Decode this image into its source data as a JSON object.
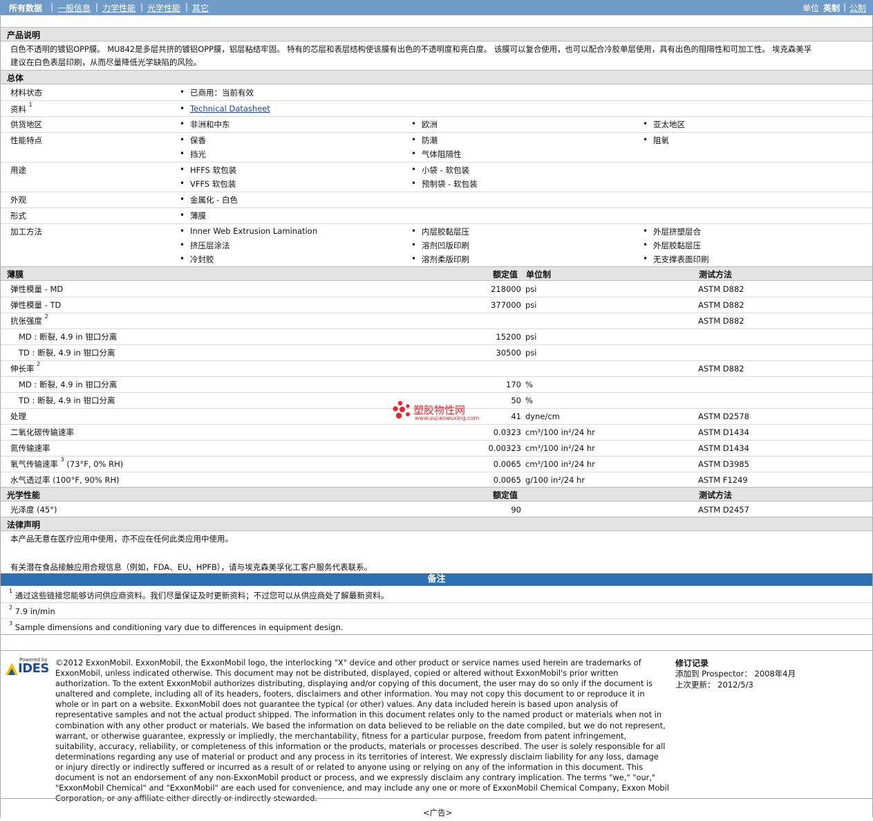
{
  "nav": {
    "items": [
      "所有数据",
      "一般信息",
      "力学性能",
      "光学性能",
      "其它"
    ],
    "separator": "|",
    "units_label": "单位",
    "unit_english": "英制",
    "unit_metric": "公制"
  },
  "product": {
    "heading": "产品说明",
    "line1": "白色不透明的镀铝OPP膜。 MU842是多层共挤的镀铝OPP膜，铝层粘结牢固。 特有的芯层和表层结构使该膜有出色的不透明度和亮白度。 该膜可以复合使用，也可以配合冷胶单层使用，具有出色的阻隔性和可加工性。 埃克森美孚",
    "line2": "建议在白色表层印刷，从而尽量降低光学缺陷的风险。"
  },
  "general": {
    "heading": "总体",
    "rows": [
      {
        "label": "材料状态",
        "values": [
          "已商用：当前有效"
        ]
      },
      {
        "label": "资料",
        "sup": "1",
        "link": "Technical Datasheet"
      },
      {
        "label": "供货地区",
        "values": [
          "非洲和中东",
          "欧洲",
          "亚太地区"
        ]
      },
      {
        "label": "性能特点",
        "values": [
          "保香",
          "防潮",
          "阻氧",
          "挡光",
          "气体阻隔性"
        ]
      },
      {
        "label": "用途",
        "values": [
          "HFFS 软包装",
          "小袋 - 软包装",
          "VFFS 软包装",
          "预制袋 - 软包装"
        ]
      },
      {
        "label": "外观",
        "values": [
          "金属化 - 白色"
        ]
      },
      {
        "label": "形式",
        "values": [
          "薄膜"
        ]
      },
      {
        "label": "加工方法",
        "values": [
          "Inner Web Extrusion Lamination",
          "内层胶黏层压",
          "外层挤塑层合",
          "挤压层涂法",
          "溶剂凹版印刷",
          "外层胶黏层压",
          "冷封胶",
          "溶剂柔版印刷",
          "无支撑表面印刷"
        ]
      }
    ]
  },
  "film": {
    "heading": "薄膜",
    "col_value": "额定值",
    "col_unit": "单位制",
    "col_method": "测试方法",
    "rows": [
      {
        "label": "弹性模量 - MD",
        "value": "218000",
        "unit": "psi",
        "method": "ASTM D882"
      },
      {
        "label": "弹性模量 - TD",
        "value": "377000",
        "unit": "psi",
        "method": "ASTM D882"
      },
      {
        "label": "抗张强度",
        "sup": "2",
        "value": "",
        "unit": "",
        "method": "ASTM D882"
      },
      {
        "label": "MD : 断裂, 4.9 in 钳口分离",
        "value": "15200",
        "unit": "psi",
        "method": ""
      },
      {
        "label": "TD : 断裂, 4.9 in 钳口分离",
        "value": "30500",
        "unit": "psi",
        "method": ""
      },
      {
        "label": "伸长率",
        "sup": "2",
        "value": "",
        "unit": "",
        "method": "ASTM D882"
      },
      {
        "label": "MD : 断裂, 4.9 in 钳口分离",
        "value": "170",
        "unit": "%",
        "method": ""
      },
      {
        "label": "TD : 断裂, 4.9 in 钳口分离",
        "value": "50",
        "unit": "%",
        "method": ""
      },
      {
        "label": "处理",
        "value": "41",
        "unit": "dyne/cm",
        "method": "ASTM D2578"
      },
      {
        "label": "二氧化碳传输速率",
        "value": "0.0323",
        "unit": "cm³/100 in²/24 hr",
        "method": "ASTM D1434"
      },
      {
        "label": "氮传输速率",
        "value": "0.00323",
        "unit": "cm³/100 in²/24 hr",
        "method": "ASTM D1434"
      },
      {
        "label": "氧气传输速率",
        "sup": "3",
        "suffix": "(73°F, 0% RH)",
        "value": "0.0065",
        "unit": "cm³/100 in²/24 hr",
        "method": "ASTM D3985"
      },
      {
        "label": "水气透过率 (100°F, 90% RH)",
        "value": "0.0065",
        "unit": "g/100 in²/24 hr",
        "method": "ASTM F1249"
      }
    ]
  },
  "optical": {
    "heading": "光学性能",
    "col_value": "额定值",
    "col_method": "测试方法",
    "row": {
      "label": "光泽度 (45°)",
      "value": "90",
      "method": "ASTM D2457"
    }
  },
  "legal": {
    "heading": "法律声明",
    "line1": "本产品无意在医疗应用中使用，亦不应在任何此类应用中使用。",
    "line2": "有关潜在食品接触应用合规信息（例如，FDA、EU、HPFB），请与埃克森美孚化工客户服务代表联系。"
  },
  "notes": {
    "heading": "备注",
    "items": [
      {
        "n": "1",
        "text": "通过这些链接您能够访问供应商资料。我们尽量保证及时更新资料；不过您可以从供应商处了解最新资料。"
      },
      {
        "n": "2",
        "text": "7.9 in/min"
      },
      {
        "n": "3",
        "text": "Sample dimensions and conditioning vary due to differences in equipment design."
      }
    ]
  },
  "watermark": {
    "name": "塑胶物性网",
    "url": "www.sujiaowuxing.com"
  },
  "footer": {
    "powered_by": "Powered by",
    "logo": "IDES",
    "copyright": "©2012 ExxonMobil. ExxonMobil, the ExxonMobil logo, the interlocking \"X\" device and other product or service names used herein are trademarks of ExxonMobil, unless indicated otherwise. This document may not be distributed, displayed, copied or altered without ExxonMobil's prior written authorization. To the extent ExxonMobil authorizes distributing, displaying and/or copying of this document, the user may do so only if the document is unaltered and complete, including all of its headers, footers, disclaimers and other information. You may not copy this document to or reproduce it in whole or in part on a website. ExxonMobil does not guarantee the typical (or other) values. Any data included herein is based upon analysis of representative samples and not the actual product shipped. The information in this document relates only to the named product or materials when not in combination with any other product or materials. We based the information on data believed to be reliable on the date compiled, but we do not represent, warrant, or otherwise guarantee, expressly or impliedly, the merchantability, fitness for a particular purpose, freedom from patent infringement, suitability, accuracy, reliability, or completeness of this information or the products, materials or processes described. The user is solely responsible for all determinations regarding any use of material or product and any process in its territories of interest. We expressly disclaim liability for any loss, damage or injury directly or indirectly suffered or incurred as a result of or related to anyone using or relying on any of the information in this document. This document is not an endorsement of any non-ExxonMobil product or process, and we expressly disclaim any contrary implication. The terms \"we,\" \"our,\" \"ExxonMobil Chemical\" and \"ExxonMobil\" are each used for convenience, and may include any one or more of ExxonMobil Chemical Company, Exxon Mobil Corporation, or any affiliate either directly or indirectly stewarded.",
    "revision_heading": "修订记录",
    "added_label": "添加到 Prospector：",
    "added_value": "2008年4月",
    "updated_label": "上次更新：",
    "updated_value": "2012/5/3",
    "ad": "<广告>"
  },
  "colors": {
    "nav_bg": "#6f9bc9",
    "notes_bg": "#2d6fb0",
    "section_bg": "#e3e3e3",
    "link": "#1a3ccc"
  }
}
